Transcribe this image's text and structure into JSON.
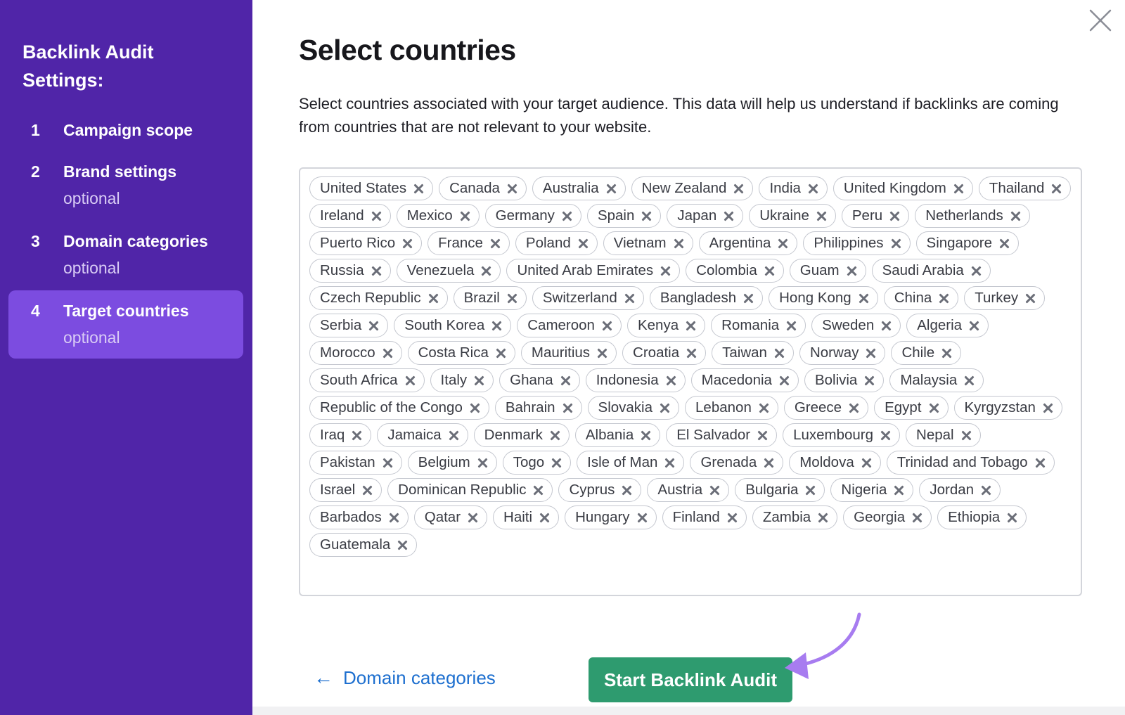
{
  "sidebar": {
    "title": "Backlink Audit Settings:",
    "steps": [
      {
        "num": "1",
        "label": "Campaign scope",
        "sub": ""
      },
      {
        "num": "2",
        "label": "Brand settings",
        "sub": "optional"
      },
      {
        "num": "3",
        "label": "Domain categories",
        "sub": "optional"
      },
      {
        "num": "4",
        "label": "Target countries",
        "sub": "optional"
      }
    ]
  },
  "main": {
    "title": "Select countries",
    "description": "Select countries associated with your target audience. This data will help us understand if backlinks are coming from countries that are not relevant to your website.",
    "countries": [
      "United States",
      "Canada",
      "Australia",
      "New Zealand",
      "India",
      "United Kingdom",
      "Thailand",
      "Ireland",
      "Mexico",
      "Germany",
      "Spain",
      "Japan",
      "Ukraine",
      "Peru",
      "Netherlands",
      "Puerto Rico",
      "France",
      "Poland",
      "Vietnam",
      "Argentina",
      "Philippines",
      "Singapore",
      "Russia",
      "Venezuela",
      "United Arab Emirates",
      "Colombia",
      "Guam",
      "Saudi Arabia",
      "Czech Republic",
      "Brazil",
      "Switzerland",
      "Bangladesh",
      "Hong Kong",
      "China",
      "Turkey",
      "Serbia",
      "South Korea",
      "Cameroon",
      "Kenya",
      "Romania",
      "Sweden",
      "Algeria",
      "Morocco",
      "Costa Rica",
      "Mauritius",
      "Croatia",
      "Taiwan",
      "Norway",
      "Chile",
      "South Africa",
      "Italy",
      "Ghana",
      "Indonesia",
      "Macedonia",
      "Bolivia",
      "Malaysia",
      "Republic of the Congo",
      "Bahrain",
      "Slovakia",
      "Lebanon",
      "Greece",
      "Egypt",
      "Kyrgyzstan",
      "Iraq",
      "Jamaica",
      "Denmark",
      "Albania",
      "El Salvador",
      "Luxembourg",
      "Nepal",
      "Pakistan",
      "Belgium",
      "Togo",
      "Isle of Man",
      "Grenada",
      "Moldova",
      "Trinidad and Tobago",
      "Israel",
      "Dominican Republic",
      "Cyprus",
      "Austria",
      "Bulgaria",
      "Nigeria",
      "Jordan",
      "Barbados",
      "Qatar",
      "Haiti",
      "Hungary",
      "Finland",
      "Zambia",
      "Georgia",
      "Ethiopia",
      "Guatemala"
    ],
    "back_label": "Domain categories",
    "start_label": "Start Backlink Audit"
  },
  "colors": {
    "sidebar_bg": "#5025a8",
    "active_step_bg": "#7c4ce0",
    "primary_button": "#2e9b6f",
    "link": "#1d6fcf",
    "annotation_arrow": "#a77cf0"
  },
  "icons": [
    "close-icon",
    "remove-tag-icon",
    "back-arrow-icon"
  ]
}
